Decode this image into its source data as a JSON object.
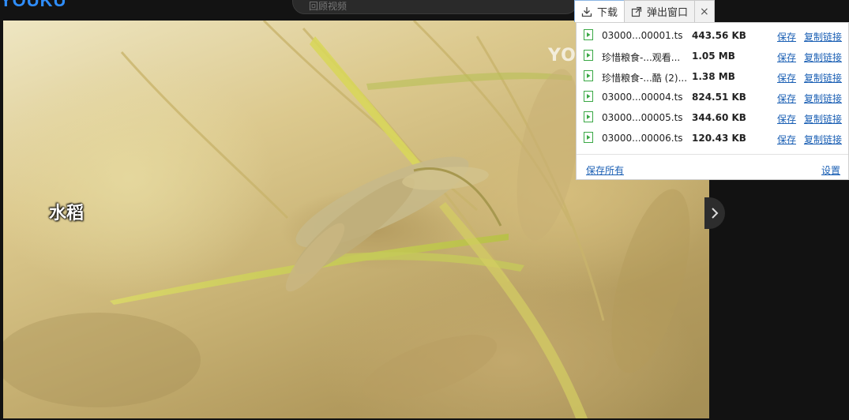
{
  "site": {
    "logo_text": "YOUKU",
    "search_text": "回顾视频"
  },
  "video": {
    "watermark": "YO",
    "caption": "水稻"
  },
  "popup": {
    "tabs": [
      {
        "label": "下载",
        "icon": "download-icon"
      },
      {
        "label": "弹出窗口",
        "icon": "external-window-icon"
      }
    ],
    "close_glyph": "×",
    "save_label": "保存",
    "copy_label": "复制链接",
    "files": [
      {
        "name": "03000...00001.ts",
        "size": "443.56 KB"
      },
      {
        "name": "珍惜粮食-...观看...",
        "size": "1.05 MB"
      },
      {
        "name": "珍惜粮食-...酷 (2)...",
        "size": "1.38 MB"
      },
      {
        "name": "03000...00004.ts",
        "size": "824.51 KB"
      },
      {
        "name": "03000...00005.ts",
        "size": "344.60 KB"
      },
      {
        "name": "03000...00006.ts",
        "size": "120.43 KB"
      }
    ],
    "footer": {
      "save_all_label": "保存所有",
      "settings_label": "设置"
    }
  },
  "colors": {
    "accent_link": "#1a5fb4",
    "file_icon_green": "#3aa845",
    "logo_blue": "#2f8dfa"
  }
}
